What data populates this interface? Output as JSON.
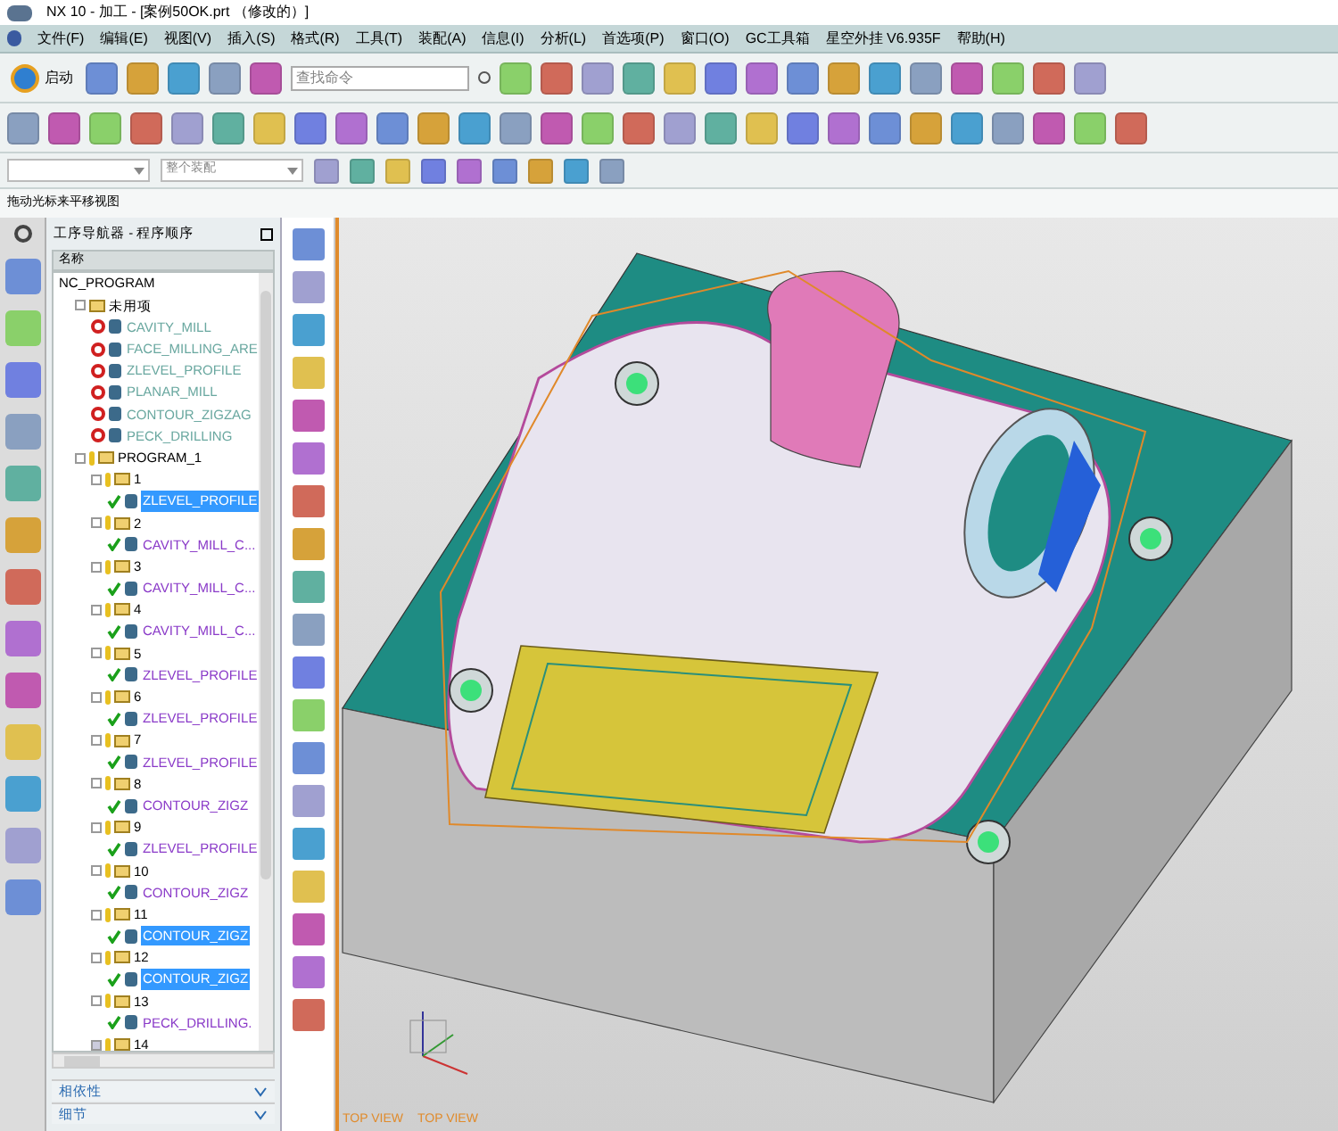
{
  "window": {
    "title": "NX 10 - 加工 - [案例50OK.prt （修改的）]"
  },
  "menu": [
    "文件(F)",
    "编辑(E)",
    "视图(V)",
    "插入(S)",
    "格式(R)",
    "工具(T)",
    "装配(A)",
    "信息(I)",
    "分析(L)",
    "首选项(P)",
    "窗口(O)",
    "GC工具箱",
    "星空外挂 V6.935F",
    "帮助(H)"
  ],
  "toolbar": {
    "start_label": "启动",
    "search": {
      "placeholder": "查找命令"
    },
    "assembly_scope": {
      "value": "整个装配"
    }
  },
  "hint": "拖动光标来平移视图",
  "navigator": {
    "title": "工序导航器 - 程序顺序",
    "column": "名称",
    "tree": {
      "label": "NC_PROGRAM",
      "children": [
        {
          "label": "未用项",
          "kind": "folder",
          "expanded": true,
          "children": [
            {
              "label": "CAVITY_MILL",
              "kind": "operation",
              "complete": false,
              "selected": false
            },
            {
              "label": "FACE_MILLING_ARE",
              "kind": "operation",
              "complete": false,
              "selected": false
            },
            {
              "label": "ZLEVEL_PROFILE",
              "kind": "operation",
              "complete": false,
              "selected": false
            },
            {
              "label": "PLANAR_MILL",
              "kind": "operation",
              "complete": false,
              "selected": false
            },
            {
              "label": "CONTOUR_ZIGZAG",
              "kind": "operation",
              "complete": false,
              "selected": false
            },
            {
              "label": "PECK_DRILLING",
              "kind": "operation",
              "complete": false,
              "selected": false
            }
          ]
        },
        {
          "label": "PROGRAM_1",
          "kind": "program",
          "expanded": true,
          "children": [
            {
              "label": "1",
              "kind": "program",
              "expanded": true,
              "children": [
                {
                  "label": "ZLEVEL_PROFILE",
                  "kind": "operation",
                  "complete": true,
                  "selected": true
                }
              ]
            },
            {
              "label": "2",
              "kind": "program",
              "expanded": true,
              "children": [
                {
                  "label": "CAVITY_MILL_C...",
                  "kind": "operation",
                  "complete": true,
                  "selected": false
                }
              ]
            },
            {
              "label": "3",
              "kind": "program",
              "expanded": true,
              "children": [
                {
                  "label": "CAVITY_MILL_C...",
                  "kind": "operation",
                  "complete": true,
                  "selected": false
                }
              ]
            },
            {
              "label": "4",
              "kind": "program",
              "expanded": true,
              "children": [
                {
                  "label": "CAVITY_MILL_C...",
                  "kind": "operation",
                  "complete": true,
                  "selected": false
                }
              ]
            },
            {
              "label": "5",
              "kind": "program",
              "expanded": true,
              "children": [
                {
                  "label": "ZLEVEL_PROFILE",
                  "kind": "operation",
                  "complete": true,
                  "selected": false
                }
              ]
            },
            {
              "label": "6",
              "kind": "program",
              "expanded": true,
              "children": [
                {
                  "label": "ZLEVEL_PROFILE",
                  "kind": "operation",
                  "complete": true,
                  "selected": false
                }
              ]
            },
            {
              "label": "7",
              "kind": "program",
              "expanded": true,
              "children": [
                {
                  "label": "ZLEVEL_PROFILE",
                  "kind": "operation",
                  "complete": true,
                  "selected": false
                }
              ]
            },
            {
              "label": "8",
              "kind": "program",
              "expanded": true,
              "children": [
                {
                  "label": "CONTOUR_ZIGZ",
                  "kind": "operation",
                  "complete": true,
                  "selected": false
                }
              ]
            },
            {
              "label": "9",
              "kind": "program",
              "expanded": true,
              "children": [
                {
                  "label": "ZLEVEL_PROFILE",
                  "kind": "operation",
                  "complete": true,
                  "selected": false
                }
              ]
            },
            {
              "label": "10",
              "kind": "program",
              "expanded": true,
              "children": [
                {
                  "label": "CONTOUR_ZIGZ",
                  "kind": "operation",
                  "complete": true,
                  "selected": false
                }
              ]
            },
            {
              "label": "11",
              "kind": "program",
              "expanded": true,
              "children": [
                {
                  "label": "CONTOUR_ZIGZ",
                  "kind": "operation",
                  "complete": true,
                  "selected": true
                }
              ]
            },
            {
              "label": "12",
              "kind": "program",
              "expanded": true,
              "children": [
                {
                  "label": "CONTOUR_ZIGZ",
                  "kind": "operation",
                  "complete": true,
                  "selected": true
                }
              ]
            },
            {
              "label": "13",
              "kind": "program",
              "expanded": true,
              "children": [
                {
                  "label": "PECK_DRILLING.",
                  "kind": "operation",
                  "complete": true,
                  "selected": false
                }
              ]
            },
            {
              "label": "14",
              "kind": "program",
              "expanded": false
            }
          ]
        }
      ]
    }
  },
  "panels": [
    {
      "label": "相依性",
      "expanded": false
    },
    {
      "label": "细节",
      "expanded": false
    }
  ],
  "viewport": {
    "view_labels": [
      "TOP VIEW",
      "TOP VIEW"
    ]
  }
}
